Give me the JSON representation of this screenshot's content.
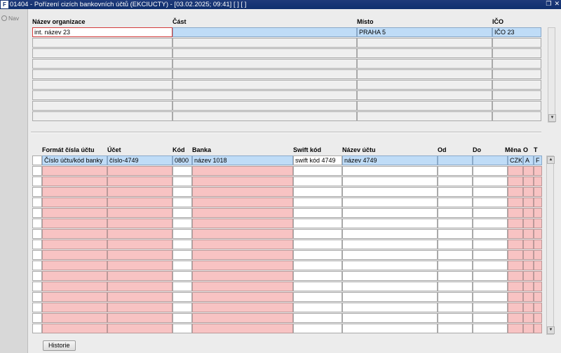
{
  "window": {
    "title": "01404 - Pořízení cizích bankovních účtů (EKCIUCTY) - [03.02.2025; 09:41]  [ ]  [ ]",
    "logo": "F",
    "controls": [
      "restore-icon",
      "close-icon"
    ]
  },
  "nav": {
    "label": "Nav"
  },
  "org_block": {
    "headers": {
      "nazev": "Název organizace",
      "cast": "Část",
      "misto": "Místo",
      "ico": "IČO"
    },
    "rows": [
      {
        "nazev": "int. název 23",
        "cast": "",
        "misto": "PRAHA 5",
        "ico": "IČO 23"
      }
    ],
    "visible_rows": 9
  },
  "account_block": {
    "headers": {
      "format": "Formát čísla účtu",
      "ucet": "Účet",
      "kod": "Kód",
      "banka": "Banka",
      "swift": "Swift kód",
      "nazev": "Název účtu",
      "od": "Od",
      "do": "Do",
      "mena": "Měna",
      "o": "O",
      "t": "T"
    },
    "rows": [
      {
        "format": "Číslo účtu/kód banky",
        "ucet": "číslo-4749",
        "kod": "0800",
        "banka": "název 1018",
        "swift": "swift kód 4749",
        "nazev": "název 4749",
        "od": "",
        "do": "",
        "mena": "CZK",
        "o": "A",
        "t": "F"
      }
    ],
    "visible_rows": 17
  },
  "buttons": {
    "historie": "Historie"
  }
}
